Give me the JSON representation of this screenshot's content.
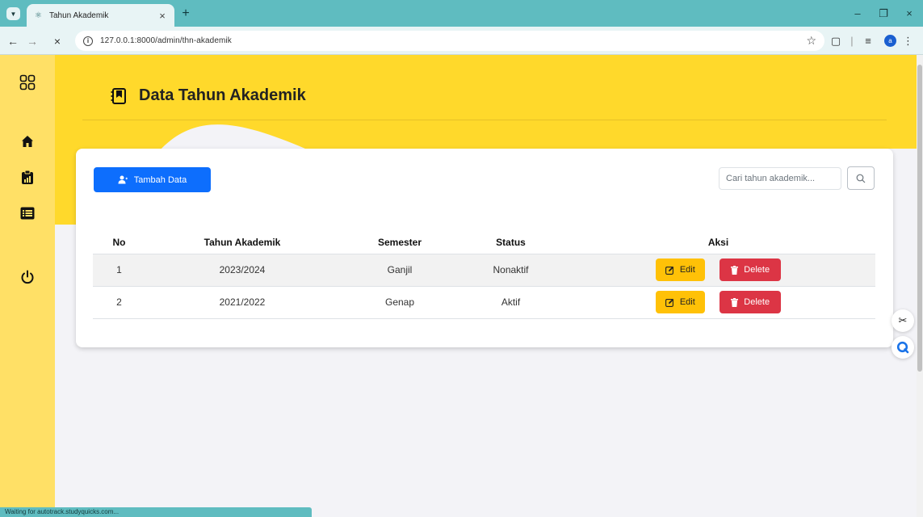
{
  "browser": {
    "tab_title": "Tahun Akademik",
    "url": "127.0.0.1:8000/admin/thn-akademik",
    "status_text": "Waiting for autotrack.studyquicks.com..."
  },
  "page": {
    "title": "Data Tahun Akademik",
    "add_button": "Tambah Data",
    "search_placeholder": "Cari tahun akademik..."
  },
  "table": {
    "headers": [
      "No",
      "Tahun Akademik",
      "Semester",
      "Status",
      "Aksi"
    ],
    "rows": [
      {
        "no": "1",
        "tahun": "2023/2024",
        "semester": "Ganjil",
        "status": "Nonaktif"
      },
      {
        "no": "2",
        "tahun": "2021/2022",
        "semester": "Genap",
        "status": "Aktif"
      }
    ],
    "edit_label": "Edit",
    "delete_label": "Delete"
  },
  "colors": {
    "primary": "#0d6efd",
    "warning": "#ffc107",
    "danger": "#dc3545",
    "hero": "#ffd92b",
    "sidebar": "#ffe066"
  }
}
